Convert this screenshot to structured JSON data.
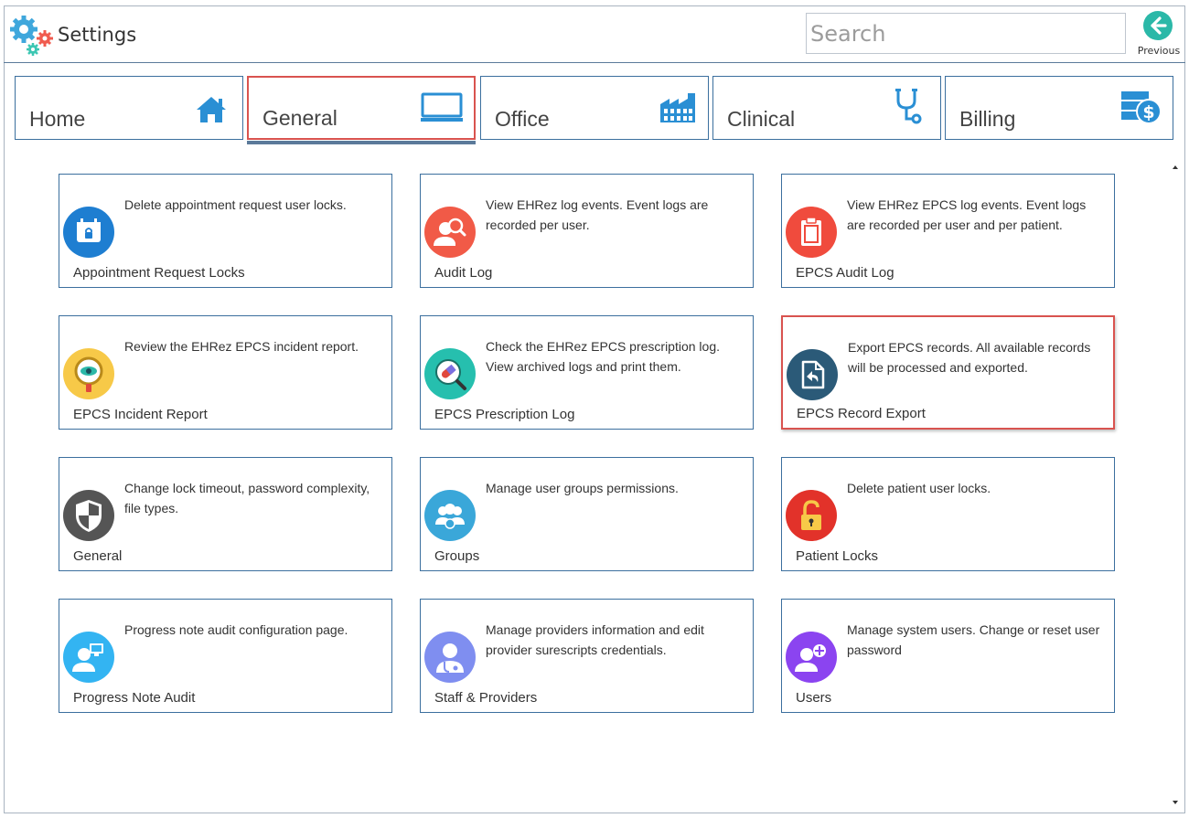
{
  "app": {
    "title": "Settings"
  },
  "search": {
    "placeholder": "Search"
  },
  "previous": {
    "label": "Previous"
  },
  "colors": {
    "accent": "#3b6f9e",
    "highlight": "#d9534f",
    "icon_blue": "#2a9fd8"
  },
  "tabs": [
    {
      "label": "Home",
      "icon": "house-icon"
    },
    {
      "label": "General",
      "icon": "monitor-icon",
      "selected": true
    },
    {
      "label": "Office",
      "icon": "factory-icon"
    },
    {
      "label": "Clinical",
      "icon": "stethoscope-icon"
    },
    {
      "label": "Billing",
      "icon": "billing-dollar-icon"
    }
  ],
  "tiles": [
    {
      "title": "Appointment Request Locks",
      "description": "Delete appointment request user locks.",
      "icon": "calendar-lock-icon",
      "color": "#1e7ed1"
    },
    {
      "title": "Audit Log",
      "description": "View EHRez log events. Event logs are recorded per user.",
      "icon": "user-search-icon",
      "color": "#f15a47"
    },
    {
      "title": "EPCS Audit Log",
      "description": "View EHRez EPCS log events. Event logs are recorded per user and per patient.",
      "icon": "clipboard-icon",
      "color": "#f04b3d"
    },
    {
      "title": "EPCS Incident Report",
      "description": "Review the EHRez EPCS incident report.",
      "icon": "magnifier-eye-icon",
      "color": "#f7c948"
    },
    {
      "title": "EPCS Prescription Log",
      "description": "Check the EHRez EPCS prescription log. View archived logs and print them.",
      "icon": "pill-magnifier-icon",
      "color": "#26bfae"
    },
    {
      "title": "EPCS Record Export",
      "description": "Export EPCS records. All available records will be processed and exported.",
      "icon": "document-export-icon",
      "color": "#2b5a78",
      "highlighted": true
    },
    {
      "title": "General",
      "description": "Change lock timeout, password complexity, file types.",
      "icon": "shield-icon",
      "color": "#555555"
    },
    {
      "title": "Groups",
      "description": "Manage user groups permissions.",
      "icon": "user-group-icon",
      "color": "#3aa7d9"
    },
    {
      "title": "Patient Locks",
      "description": "Delete patient user locks.",
      "icon": "padlock-open-icon",
      "color": "#e2322a"
    },
    {
      "title": "Progress Note Audit",
      "description": "Progress note audit configuration page.",
      "icon": "user-monitor-icon",
      "color": "#33b4f2"
    },
    {
      "title": "Staff & Providers",
      "description": "Manage providers information and edit provider surescripts credentials.",
      "icon": "doctor-stethoscope-icon",
      "color": "#7f8ef0"
    },
    {
      "title": "Users",
      "description": "Manage system users. Change or reset user password",
      "icon": "user-add-icon",
      "color": "#8b44f0"
    }
  ]
}
